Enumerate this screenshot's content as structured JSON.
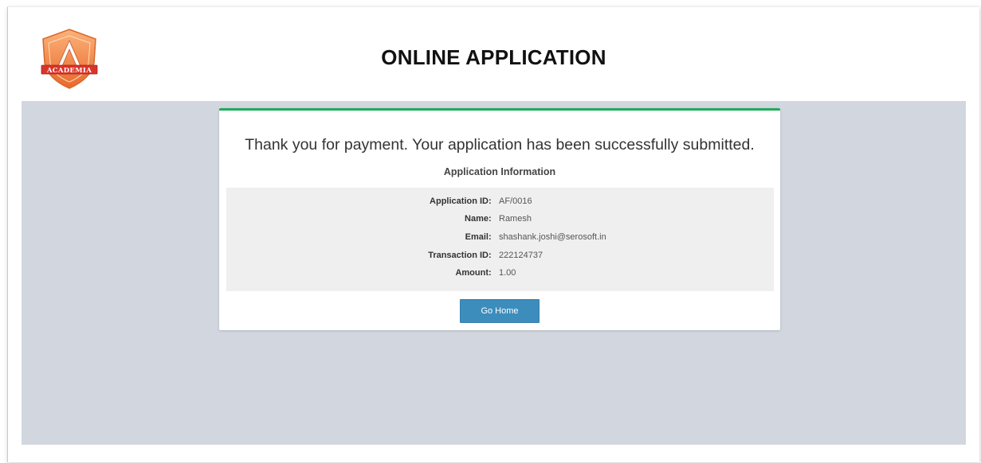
{
  "header": {
    "title": "ONLINE APPLICATION",
    "logo_text": "ACADEMIA"
  },
  "card": {
    "message": "Thank you for payment. Your application has been successfully submitted.",
    "section_title": "Application Information",
    "fields": [
      {
        "label": "Application ID",
        "value": "AF/0016"
      },
      {
        "label": "Name",
        "value": "Ramesh"
      },
      {
        "label": "Email",
        "value": "shashank.joshi@serosoft.in"
      },
      {
        "label": "Transaction ID",
        "value": "222124737"
      },
      {
        "label": "Amount",
        "value": "1.00"
      }
    ],
    "separator": ":",
    "button_label": "Go Home"
  },
  "colors": {
    "accent_green": "#1fab5a",
    "button_blue": "#3c8dbc",
    "background_gray": "#d2d7df",
    "info_box_gray": "#efefef",
    "logo_orange": "#f07f3a",
    "logo_red": "#d9342b"
  }
}
